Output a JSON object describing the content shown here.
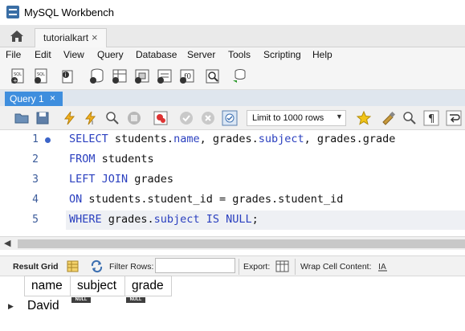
{
  "window": {
    "title": "MySQL Workbench"
  },
  "tabs": {
    "connection": "tutorialkart",
    "close_glyph": "×"
  },
  "menu": [
    "File",
    "Edit",
    "View",
    "Query",
    "Database",
    "Server",
    "Tools",
    "Scripting",
    "Help"
  ],
  "query_tab": {
    "label": "Query 1",
    "close_glyph": "×"
  },
  "sql_toolbar": {
    "limit_label": "Limit to 1000 rows"
  },
  "editor": {
    "line_numbers": [
      "1",
      "2",
      "3",
      "4",
      "5"
    ],
    "lines": [
      {
        "parts": [
          {
            "t": "SELECT",
            "c": "kw"
          },
          {
            "t": " students."
          },
          {
            "t": "name",
            "c": "fld"
          },
          {
            "t": ", grades."
          },
          {
            "t": "subject",
            "c": "fld"
          },
          {
            "t": ", grades.grade"
          }
        ]
      },
      {
        "parts": [
          {
            "t": "FROM",
            "c": "kw"
          },
          {
            "t": " students"
          }
        ]
      },
      {
        "parts": [
          {
            "t": "LEFT JOIN",
            "c": "kw"
          },
          {
            "t": " grades"
          }
        ]
      },
      {
        "parts": [
          {
            "t": "ON",
            "c": "kw"
          },
          {
            "t": " students.student_id = grades.student_id"
          }
        ]
      },
      {
        "parts": [
          {
            "t": "WHERE",
            "c": "kw"
          },
          {
            "t": " grades."
          },
          {
            "t": "subject",
            "c": "fld"
          },
          {
            "t": " "
          },
          {
            "t": "IS NULL",
            "c": "kw"
          },
          {
            "t": ";"
          }
        ]
      }
    ]
  },
  "result_toolbar": {
    "result_grid": "Result Grid",
    "filter_rows": "Filter Rows:",
    "filter_value": "",
    "export": "Export:",
    "wrap": "Wrap Cell Content:"
  },
  "grid": {
    "columns": [
      "name",
      "subject",
      "grade"
    ],
    "rows": [
      {
        "name": "David",
        "subject": "NULL",
        "grade": "NULL"
      }
    ]
  },
  "colors": {
    "accent": "#3e8ede",
    "keyword": "#2a3fbf"
  }
}
